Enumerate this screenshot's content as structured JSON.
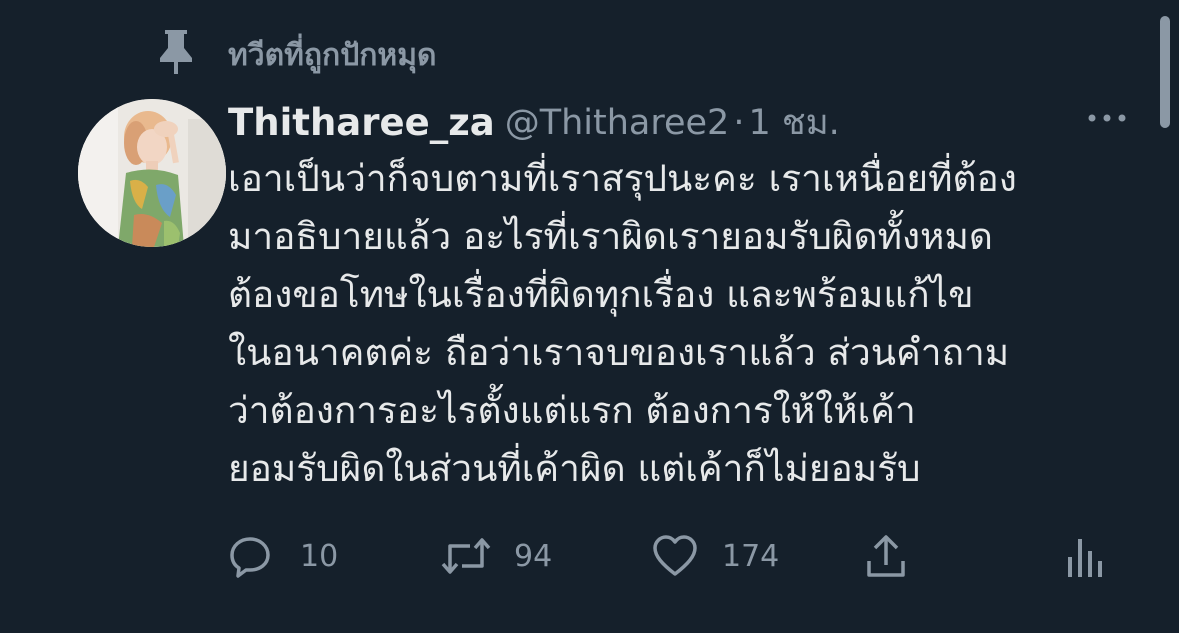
{
  "pinned": {
    "label": "ทวีตที่ถูกปักหมุด",
    "icon": "pin-icon"
  },
  "tweet": {
    "display_name": "Thitharee_za",
    "handle": "@Thitharee2",
    "separator": "·",
    "time": "1 ชม.",
    "more_icon": "more-horizontal-icon",
    "lines": [
      "เอาเป็นว่าก็จบตามที่เราสรุปนะคะ เราเหนื่อยที่ต้อง",
      "มาอธิบายแล้ว อะไรที่เราผิดเรายอมรับผิดทั้งหมด",
      "ต้องขอโทษในเรื่องที่ผิดทุกเรื่อง และพร้อมแก้ไข",
      "ในอนาคตค่ะ ถือว่าเราจบของเราแล้ว ส่วนคำถาม",
      "ว่าต้องการอะไรตั้งแต่แรก ต้องการให้ให้เค้า",
      "ยอมรับผิดในส่วนที่เค้าผิด แต่เค้าก็ไม่ยอมรับ"
    ]
  },
  "actions": {
    "reply": {
      "icon": "reply-icon",
      "count": "10"
    },
    "retweet": {
      "icon": "retweet-icon",
      "count": "94"
    },
    "like": {
      "icon": "heart-icon",
      "count": "174"
    },
    "share": {
      "icon": "share-icon"
    },
    "analytics": {
      "icon": "analytics-icon"
    }
  },
  "colors": {
    "background": "#15202b",
    "primary_text": "#e7e9ea",
    "secondary_text": "#8b98a5"
  }
}
